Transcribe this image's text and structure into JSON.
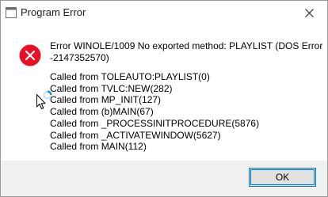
{
  "window": {
    "title": "Program Error"
  },
  "message": {
    "line1": "Error WINOLE/1009  No exported method: PLAYLIST (DOS Error",
    "line2": "-2147352570)"
  },
  "trace": [
    "Called from TOLEAUTO:PLAYLIST(0)",
    "Called from TVLC:NEW(282)",
    "Called from MP_INIT(127)",
    "Called from (b)MAIN(67)",
    "Called from _PROCESSINITPROCEDURE(5876)",
    "Called from _ACTIVATEWINDOW(5627)",
    "Called from MAIN(112)"
  ],
  "buttons": {
    "ok_label": "OK"
  },
  "icons": {
    "app": "window-app-icon",
    "close": "close-icon",
    "error": "error-icon",
    "cursor": "mouse-pointer-icon",
    "busy": "busy-spinner-icon"
  },
  "colors": {
    "error_red": "#e81123",
    "accent": "#0078d7",
    "footer_bg": "#f0f0f0"
  }
}
